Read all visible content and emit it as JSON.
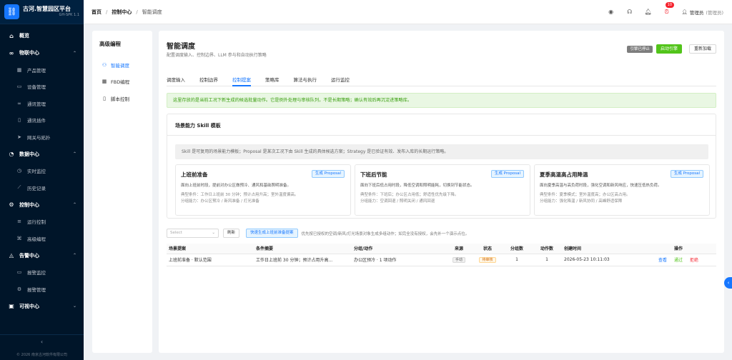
{
  "app": {
    "title": "古河.智慧园区平台",
    "subtitle": "GH-SPK 1.1",
    "copyright": "© 2026 南京古河软件有限公司"
  },
  "sidebar": {
    "groups": [
      {
        "label": "概览",
        "items": []
      },
      {
        "label": "物联中心",
        "items": [
          {
            "label": "产品管理"
          },
          {
            "label": "设备管理"
          },
          {
            "label": "通讯管理"
          },
          {
            "label": "通讯插件"
          },
          {
            "label": "网关与拓扑"
          }
        ]
      },
      {
        "label": "数据中心",
        "items": [
          {
            "label": "实时监控"
          },
          {
            "label": "历史记录"
          }
        ]
      },
      {
        "label": "控制中心",
        "items": [
          {
            "label": "运行控制"
          },
          {
            "label": "高级编程"
          }
        ]
      },
      {
        "label": "告警中心",
        "items": [
          {
            "label": "报警监控"
          },
          {
            "label": "报警管理"
          }
        ]
      },
      {
        "label": "可视中心",
        "items": []
      }
    ],
    "collapse_icon": "‹"
  },
  "header": {
    "breadcrumb": [
      "首页",
      "控制中心",
      "智能调度"
    ],
    "notification_count": "10",
    "user_name": "管理员",
    "user_role": "(管理员)"
  },
  "subnav": {
    "title": "高级编程",
    "items": [
      {
        "label": "智能调度"
      },
      {
        "label": "FBD编程"
      },
      {
        "label": "脚本控制"
      }
    ]
  },
  "page": {
    "title": "智能调度",
    "subtitle": "配置调度输入、控制边界、LLM 参与和自动执行策略",
    "engine_status": "引擎已停止",
    "start_button": "启动引擎",
    "reload_button": "重新加载",
    "tabs": [
      "调度输入",
      "控制边界",
      "控制提案",
      "策略库",
      "算法与执行",
      "运行监控"
    ],
    "active_tab": 2,
    "alert": "这里存放的是当前工况下新生成的候选批量动作。它是例外处理与审核队列，不是长期策略；确认有效后再沉淀进策略库。"
  },
  "skills": {
    "card_title": "场景能力 Skill 模板",
    "info": "Skill 是可复用的场景能力模板；Proposal 是某次工况下由 Skill 生成的具体候选方案；Strategy 是已验证有效、发布入库的长期运行策略。",
    "items": [
      {
        "name": "上班前准备",
        "button": "生成 Proposal",
        "desc": "面向上班前时段，提前对办公区做预冷、通风和基础照明准备。",
        "condition": "典型条件：工作日上班前 30 分钟；预计占用升高；室外温度偏高。",
        "groups": "分组能力：办公区预冷 / 新风准备 / 灯光准备"
      },
      {
        "name": "下班后节能",
        "button": "生成 Proposal",
        "desc": "面向下班后低占用时段，降低空调和照明能耗，切换到节能状态。",
        "condition": "典型条件：下班后；办公区占用低；舒适性优先级下降。",
        "groups": "分组能力：空调回退 / 照明关闭 / 通风回退"
      },
      {
        "name": "夏季高温高占用降温",
        "button": "生成 Proposal",
        "desc": "面向夏季高温与高负荷时段，强化空调和新风响应，快速压低热负荷。",
        "condition": "典型条件：夏季模式；室外温度高；办公区高占用。",
        "groups": "分组能力：强化降温 / 新风协同 / 高峰舒适保障"
      }
    ]
  },
  "proposals": {
    "select_placeholder": "Select",
    "refresh_button": "刷新",
    "quick_button": "快速生成上班前准备提案",
    "hint": "优先按已授权的空调/新风/灯光场景对象生成多组动作；如完全没有授权，会先补一个演示点位。",
    "columns": [
      "场景提案",
      "条件摘要",
      "分组/动作",
      "来源",
      "状态",
      "分组数",
      "动作数",
      "创建时间",
      "操作"
    ],
    "rows": [
      {
        "scene": "上班前准备 · 默认范围",
        "condition": "工作日上班前 30 分钟；预计占用升高...",
        "action": "办公区预冷 · 1 项动作",
        "source": "手动",
        "status": "待审核",
        "groups": "1",
        "actions": "1",
        "created": "2026-05-23 10:11:03",
        "op_view": "查看",
        "op_pass": "通过",
        "op_reject": "拒绝"
      }
    ]
  },
  "colors": {
    "primary": "#1677ff",
    "sidebar_bg": "#001529",
    "success": "#52c41a",
    "danger": "#f5222d"
  }
}
